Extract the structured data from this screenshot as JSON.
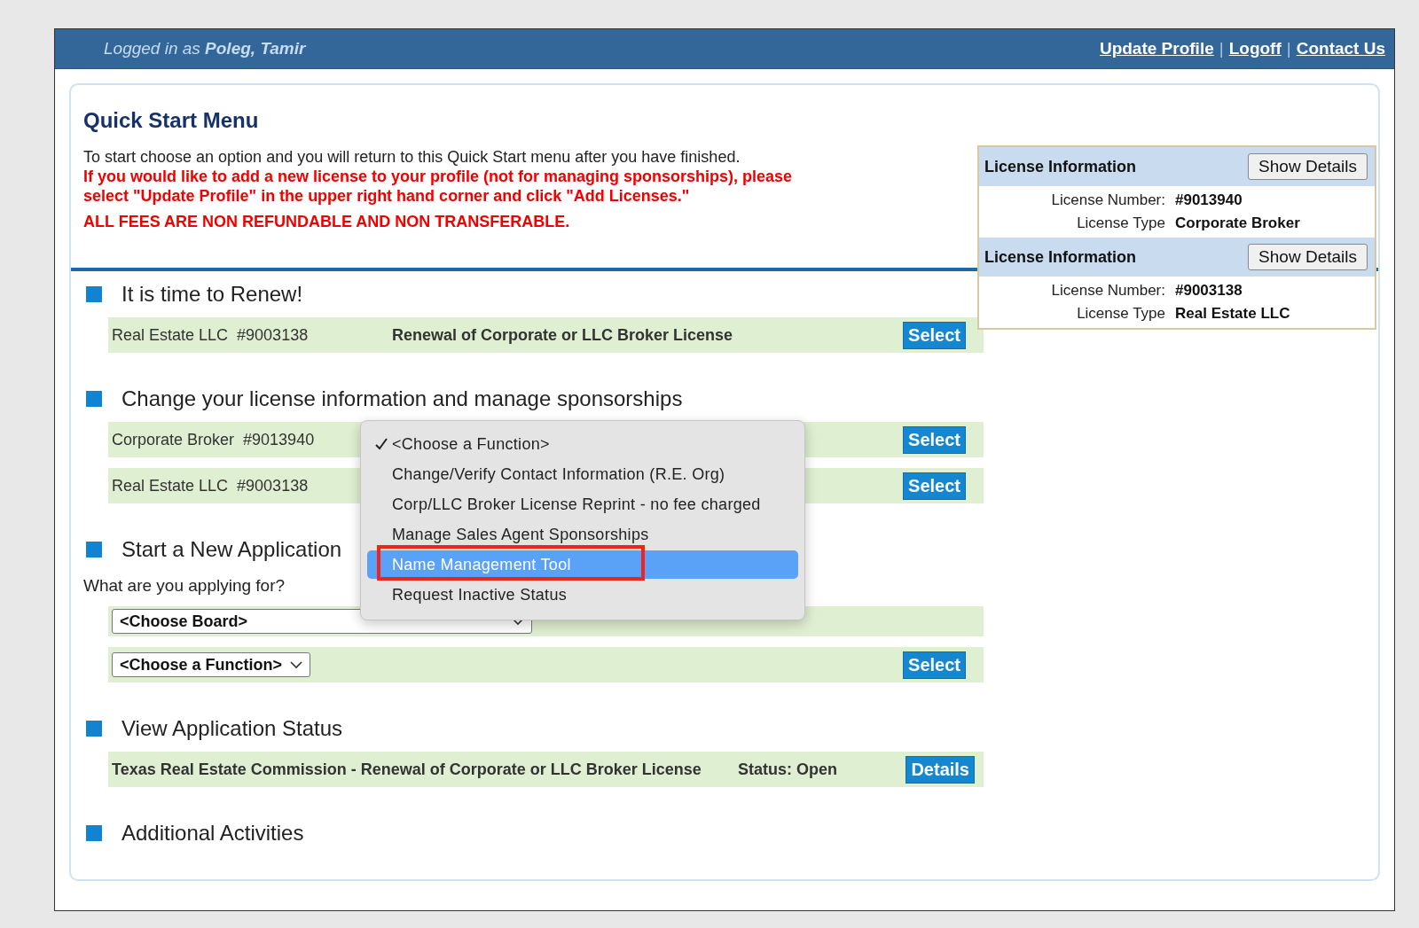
{
  "header": {
    "user_text": "Logged in as **Poleg, Tamir**",
    "links": [
      "Update Profile",
      "Logoff",
      "Contact Us"
    ],
    "separators": [
      "|",
      "|"
    ]
  },
  "title": "Quick Start Menu",
  "intro": "To start choose an option and you will return to this Quick Start menu after you have finished.",
  "notice": "If you would like to add a new license to your profile (not for managing sponsorships), please select \"Update Profile\" in the upper right hand corner and click \"Add Licenses.\"",
  "fees_notice": "ALL FEES ARE NON REFUNDABLE AND NON TRANSFERABLE.",
  "license_panel": [
    {
      "heading": "License Information",
      "button": "Show Details",
      "number_label": "License Number:",
      "number": "#9013940",
      "type_label": "License Type",
      "type": "Corporate Broker"
    },
    {
      "heading": "License Information",
      "button": "Show Details",
      "number_label": "License Number:",
      "number": "#9003138",
      "type_label": "License Type",
      "type": "Real Estate LLC"
    }
  ],
  "sections": [
    {
      "heading": "It is time to Renew!",
      "rows": [
        {
          "kind": "item",
          "label": "Real Estate LLC  #9003138",
          "description": "Renewal of Corporate or LLC Broker License",
          "button": "Select"
        }
      ]
    },
    {
      "heading": "Change your license information and manage sponsorships",
      "rows": [
        {
          "kind": "item",
          "label": "Corporate Broker  #9013940",
          "button": "Select"
        },
        {
          "kind": "item",
          "label": "Real Estate LLC  #9003138",
          "button": "Select"
        }
      ]
    },
    {
      "heading": "Start a New Application",
      "prompt": "What are you applying for?",
      "rows": [
        {
          "kind": "board",
          "select": "<Choose Board>"
        },
        {
          "kind": "function",
          "select": "<Choose a Function>",
          "button": "Select"
        }
      ]
    },
    {
      "heading": "View Application Status",
      "rows": [
        {
          "kind": "status",
          "label": "Texas Real Estate Commission - Renewal of Corporate or LLC Broker License",
          "status": "Status: Open",
          "button": "Details"
        }
      ]
    },
    {
      "heading": "Additional Activities"
    }
  ],
  "dropdown_menu": {
    "options": [
      {
        "label": "<Choose a Function>",
        "checked": true,
        "selected": false
      },
      {
        "label": "Change/Verify Contact Information (R.E. Org)",
        "checked": false,
        "selected": false
      },
      {
        "label": "Corp/LLC Broker License Reprint - no fee charged",
        "checked": false,
        "selected": false
      },
      {
        "label": "Manage Sales Agent Sponsorships",
        "checked": false,
        "selected": false
      },
      {
        "label": "Name Management Tool",
        "checked": false,
        "selected": true
      },
      {
        "label": "Request Inactive Status",
        "checked": false,
        "selected": false
      }
    ]
  }
}
